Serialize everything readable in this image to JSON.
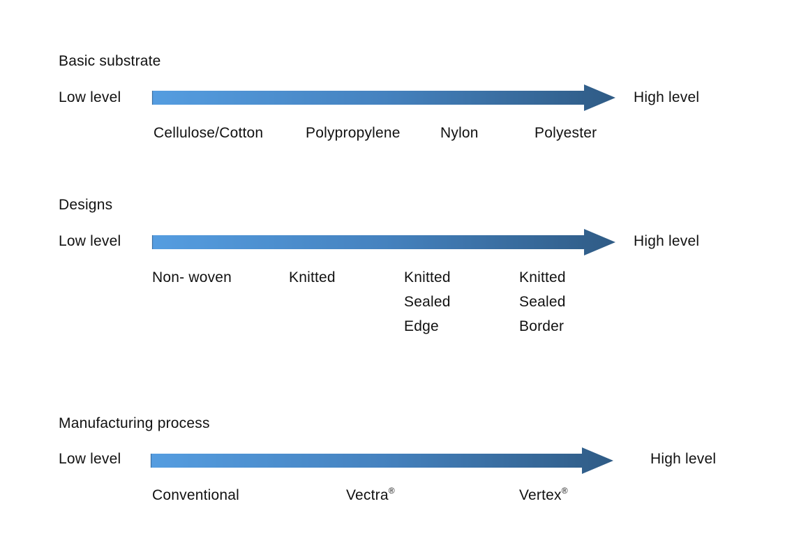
{
  "colors": {
    "arrow_start": "#559de0",
    "arrow_mid": "#4582bf",
    "arrow_end": "#2f5b85",
    "text": "#111111",
    "background": "#ffffff"
  },
  "sections": [
    {
      "title": "Basic substrate",
      "low_label": "Low level",
      "high_label": "High level",
      "arrow_icon": "gradient-right-arrow",
      "items": [
        {
          "lines": [
            "Cellulose/Cotton"
          ]
        },
        {
          "lines": [
            "Polypropylene"
          ]
        },
        {
          "lines": [
            "Nylon"
          ]
        },
        {
          "lines": [
            "Polyester"
          ]
        }
      ]
    },
    {
      "title": "Designs",
      "low_label": "Low level",
      "high_label": "High level",
      "arrow_icon": "gradient-right-arrow",
      "items": [
        {
          "lines": [
            "Non- woven"
          ]
        },
        {
          "lines": [
            "Knitted"
          ]
        },
        {
          "lines": [
            "Knitted",
            "Sealed",
            "Edge"
          ]
        },
        {
          "lines": [
            "Knitted",
            "Sealed",
            "Border"
          ]
        }
      ]
    },
    {
      "title": "Manufacturing process",
      "low_label": "Low level",
      "high_label": "High level",
      "arrow_icon": "gradient-right-arrow",
      "items": [
        {
          "lines": [
            "Conventional"
          ]
        },
        {
          "lines": [
            "Vectra"
          ],
          "mark": "®"
        },
        {
          "lines": [
            "Vertex"
          ],
          "mark": "®"
        }
      ]
    }
  ]
}
